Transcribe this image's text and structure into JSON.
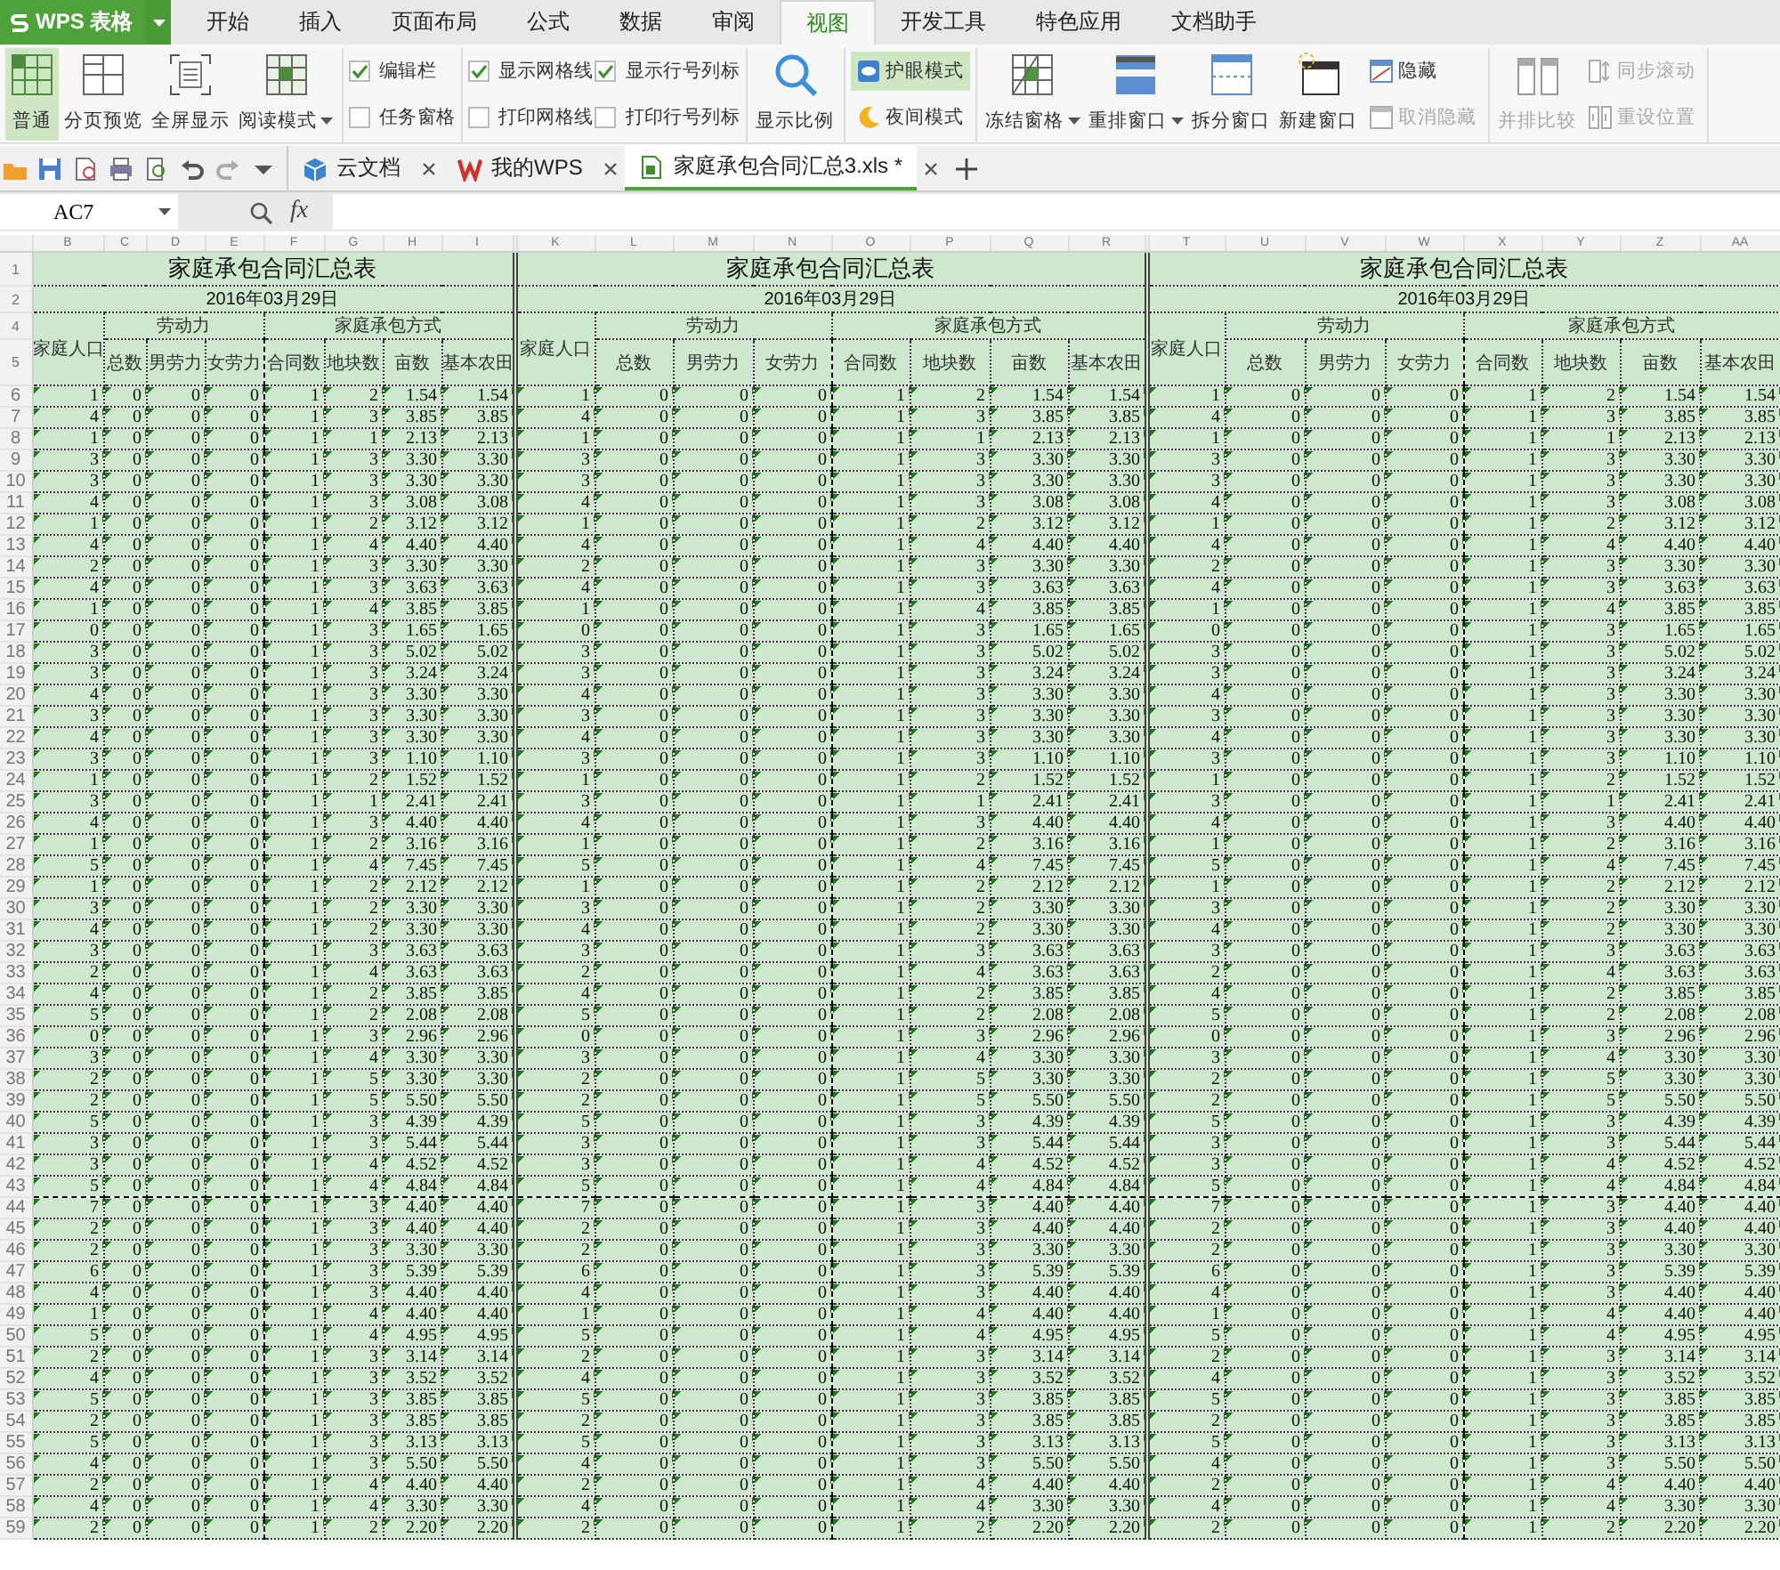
{
  "app_button": {
    "label": "WPS 表格"
  },
  "menu_tabs": [
    {
      "label": "开始",
      "selected": false
    },
    {
      "label": "插入",
      "selected": false
    },
    {
      "label": "页面布局",
      "selected": false
    },
    {
      "label": "公式",
      "selected": false
    },
    {
      "label": "数据",
      "selected": false
    },
    {
      "label": "审阅",
      "selected": false
    },
    {
      "label": "视图",
      "selected": true
    },
    {
      "label": "开发工具",
      "selected": false
    },
    {
      "label": "特色应用",
      "selected": false
    },
    {
      "label": "文档助手",
      "selected": false
    }
  ],
  "ribbon": {
    "groups": [
      {
        "items": [
          {
            "kind": "large",
            "label": "普通",
            "selected": true,
            "disabled": false,
            "dropdown": false
          },
          {
            "kind": "large",
            "label": "分页预览",
            "selected": false,
            "disabled": false,
            "dropdown": false
          },
          {
            "kind": "large",
            "label": "全屏显示",
            "selected": false,
            "disabled": false,
            "dropdown": false
          },
          {
            "kind": "large",
            "label": "阅读模式",
            "selected": false,
            "disabled": false,
            "dropdown": true
          }
        ]
      },
      {
        "items": [
          {
            "kind": "check",
            "label": "编辑栏",
            "checked": true
          },
          {
            "kind": "check",
            "label": "任务窗格",
            "checked": false
          }
        ]
      },
      {
        "items": [
          {
            "kind": "check",
            "label": "显示网格线",
            "checked": true
          },
          {
            "kind": "check",
            "label": "打印网格线",
            "checked": false
          },
          {
            "kind": "check",
            "label": "显示行号列标",
            "checked": true
          },
          {
            "kind": "check",
            "label": "打印行号列标",
            "checked": false
          }
        ]
      },
      {
        "items": [
          {
            "kind": "large",
            "label": "显示比例",
            "selected": false,
            "disabled": false,
            "dropdown": false
          }
        ]
      },
      {
        "items": [
          {
            "kind": "small",
            "label": "护眼模式",
            "selected": true,
            "disabled": false
          },
          {
            "kind": "small",
            "label": "夜间模式",
            "selected": false,
            "disabled": false
          }
        ]
      },
      {
        "items": [
          {
            "kind": "large",
            "label": "冻结窗格",
            "selected": false,
            "disabled": false,
            "dropdown": true
          },
          {
            "kind": "large",
            "label": "重排窗口",
            "selected": false,
            "disabled": false,
            "dropdown": true
          },
          {
            "kind": "large",
            "label": "拆分窗口",
            "selected": false,
            "disabled": false,
            "dropdown": false
          },
          {
            "kind": "large",
            "label": "新建窗口",
            "selected": false,
            "disabled": false,
            "dropdown": false
          },
          {
            "kind": "small",
            "label": "隐藏",
            "selected": false,
            "disabled": false
          },
          {
            "kind": "small",
            "label": "取消隐藏",
            "selected": false,
            "disabled": true
          }
        ]
      },
      {
        "items": [
          {
            "kind": "large",
            "label": "并排比较",
            "selected": false,
            "disabled": true,
            "dropdown": false
          },
          {
            "kind": "small",
            "label": "同步滚动",
            "selected": false,
            "disabled": true
          },
          {
            "kind": "small",
            "label": "重设位置",
            "selected": false,
            "disabled": true
          }
        ]
      }
    ]
  },
  "doc_tabs": [
    {
      "label": "云文档",
      "selected": false
    },
    {
      "label": "我的WPS",
      "selected": false
    },
    {
      "label": "家庭承包合同汇总3.xls *",
      "selected": true
    }
  ],
  "formula_bar": {
    "name_box": "AC7",
    "function_label": "fx"
  },
  "sheet": {
    "row_numbers": [
      "1",
      "2",
      "4",
      "5",
      "6",
      "7",
      "8",
      "9",
      "10",
      "11",
      "12",
      "13",
      "14",
      "15",
      "16",
      "17",
      "18",
      "19",
      "20",
      "21",
      "22",
      "23",
      "24",
      "25",
      "26",
      "27",
      "28",
      "29",
      "30",
      "31",
      "32",
      "33",
      "34",
      "35",
      "36",
      "37",
      "38",
      "39",
      "40",
      "41",
      "42",
      "43",
      "44",
      "45",
      "46",
      "47",
      "48",
      "49",
      "50",
      "51",
      "52",
      "53",
      "54",
      "55",
      "56",
      "57",
      "58",
      "59"
    ],
    "blocks": [
      {
        "column_letters": [
          "B",
          "C",
          "D",
          "E",
          "F",
          "G",
          "H",
          "I"
        ],
        "title": "家庭承包合同汇总表",
        "date": "2016年03月29日",
        "population_header": "家庭人口",
        "labor": {
          "label": "劳动力",
          "columns": [
            "总数",
            "男劳力",
            "女劳力"
          ]
        },
        "contract": {
          "label": "家庭承包方式",
          "columns": [
            "合同数",
            "地块数",
            "亩数",
            "基本农田"
          ]
        },
        "rows": [
          [
            "1",
            "0",
            "0",
            "0",
            "1",
            "2",
            "1.54",
            "1.54"
          ],
          [
            "4",
            "0",
            "0",
            "0",
            "1",
            "3",
            "3.85",
            "3.85"
          ],
          [
            "1",
            "0",
            "0",
            "0",
            "1",
            "1",
            "2.13",
            "2.13"
          ],
          [
            "3",
            "0",
            "0",
            "0",
            "1",
            "3",
            "3.30",
            "3.30"
          ],
          [
            "3",
            "0",
            "0",
            "0",
            "1",
            "3",
            "3.30",
            "3.30"
          ],
          [
            "4",
            "0",
            "0",
            "0",
            "1",
            "3",
            "3.08",
            "3.08"
          ],
          [
            "1",
            "0",
            "0",
            "0",
            "1",
            "2",
            "3.12",
            "3.12"
          ],
          [
            "4",
            "0",
            "0",
            "0",
            "1",
            "4",
            "4.40",
            "4.40"
          ],
          [
            "2",
            "0",
            "0",
            "0",
            "1",
            "3",
            "3.30",
            "3.30"
          ],
          [
            "4",
            "0",
            "0",
            "0",
            "1",
            "3",
            "3.63",
            "3.63"
          ],
          [
            "1",
            "0",
            "0",
            "0",
            "1",
            "4",
            "3.85",
            "3.85"
          ],
          [
            "0",
            "0",
            "0",
            "0",
            "1",
            "3",
            "1.65",
            "1.65"
          ],
          [
            "3",
            "0",
            "0",
            "0",
            "1",
            "3",
            "5.02",
            "5.02"
          ],
          [
            "3",
            "0",
            "0",
            "0",
            "1",
            "3",
            "3.24",
            "3.24"
          ],
          [
            "4",
            "0",
            "0",
            "0",
            "1",
            "3",
            "3.30",
            "3.30"
          ],
          [
            "3",
            "0",
            "0",
            "0",
            "1",
            "3",
            "3.30",
            "3.30"
          ],
          [
            "4",
            "0",
            "0",
            "0",
            "1",
            "3",
            "3.30",
            "3.30"
          ],
          [
            "3",
            "0",
            "0",
            "0",
            "1",
            "3",
            "1.10",
            "1.10"
          ],
          [
            "1",
            "0",
            "0",
            "0",
            "1",
            "2",
            "1.52",
            "1.52"
          ],
          [
            "3",
            "0",
            "0",
            "0",
            "1",
            "1",
            "2.41",
            "2.41"
          ],
          [
            "4",
            "0",
            "0",
            "0",
            "1",
            "3",
            "4.40",
            "4.40"
          ],
          [
            "1",
            "0",
            "0",
            "0",
            "1",
            "2",
            "3.16",
            "3.16"
          ],
          [
            "5",
            "0",
            "0",
            "0",
            "1",
            "4",
            "7.45",
            "7.45"
          ],
          [
            "1",
            "0",
            "0",
            "0",
            "1",
            "2",
            "2.12",
            "2.12"
          ],
          [
            "3",
            "0",
            "0",
            "0",
            "1",
            "2",
            "3.30",
            "3.30"
          ],
          [
            "4",
            "0",
            "0",
            "0",
            "1",
            "2",
            "3.30",
            "3.30"
          ],
          [
            "3",
            "0",
            "0",
            "0",
            "1",
            "3",
            "3.63",
            "3.63"
          ],
          [
            "2",
            "0",
            "0",
            "0",
            "1",
            "4",
            "3.63",
            "3.63"
          ],
          [
            "4",
            "0",
            "0",
            "0",
            "1",
            "2",
            "3.85",
            "3.85"
          ],
          [
            "5",
            "0",
            "0",
            "0",
            "1",
            "2",
            "2.08",
            "2.08"
          ],
          [
            "0",
            "0",
            "0",
            "0",
            "1",
            "3",
            "2.96",
            "2.96"
          ],
          [
            "3",
            "0",
            "0",
            "0",
            "1",
            "4",
            "3.30",
            "3.30"
          ],
          [
            "2",
            "0",
            "0",
            "0",
            "1",
            "5",
            "3.30",
            "3.30"
          ],
          [
            "2",
            "0",
            "0",
            "0",
            "1",
            "5",
            "5.50",
            "5.50"
          ],
          [
            "5",
            "0",
            "0",
            "0",
            "1",
            "3",
            "4.39",
            "4.39"
          ],
          [
            "3",
            "0",
            "0",
            "0",
            "1",
            "3",
            "5.44",
            "5.44"
          ],
          [
            "3",
            "0",
            "0",
            "0",
            "1",
            "4",
            "4.52",
            "4.52"
          ],
          [
            "5",
            "0",
            "0",
            "0",
            "1",
            "4",
            "4.84",
            "4.84"
          ],
          [
            "7",
            "0",
            "0",
            "0",
            "1",
            "3",
            "4.40",
            "4.40"
          ],
          [
            "2",
            "0",
            "0",
            "0",
            "1",
            "3",
            "4.40",
            "4.40"
          ],
          [
            "2",
            "0",
            "0",
            "0",
            "1",
            "3",
            "3.30",
            "3.30"
          ],
          [
            "6",
            "0",
            "0",
            "0",
            "1",
            "3",
            "5.39",
            "5.39"
          ],
          [
            "4",
            "0",
            "0",
            "0",
            "1",
            "3",
            "4.40",
            "4.40"
          ],
          [
            "1",
            "0",
            "0",
            "0",
            "1",
            "4",
            "4.40",
            "4.40"
          ],
          [
            "5",
            "0",
            "0",
            "0",
            "1",
            "4",
            "4.95",
            "4.95"
          ],
          [
            "2",
            "0",
            "0",
            "0",
            "1",
            "3",
            "3.14",
            "3.14"
          ],
          [
            "4",
            "0",
            "0",
            "0",
            "1",
            "3",
            "3.52",
            "3.52"
          ],
          [
            "5",
            "0",
            "0",
            "0",
            "1",
            "3",
            "3.85",
            "3.85"
          ],
          [
            "2",
            "0",
            "0",
            "0",
            "1",
            "3",
            "3.85",
            "3.85"
          ],
          [
            "5",
            "0",
            "0",
            "0",
            "1",
            "3",
            "3.13",
            "3.13"
          ],
          [
            "4",
            "0",
            "0",
            "0",
            "1",
            "3",
            "5.50",
            "5.50"
          ],
          [
            "2",
            "0",
            "0",
            "0",
            "1",
            "4",
            "4.40",
            "4.40"
          ],
          [
            "4",
            "0",
            "0",
            "0",
            "1",
            "4",
            "3.30",
            "3.30"
          ],
          [
            "2",
            "0",
            "0",
            "0",
            "1",
            "2",
            "2.20",
            "2.20"
          ]
        ]
      },
      {
        "column_letters": [
          "K",
          "L",
          "M",
          "N",
          "O",
          "P",
          "Q",
          "R"
        ],
        "title": "家庭承包合同汇总表",
        "date": "2016年03月29日",
        "population_header": "家庭人口",
        "labor": {
          "label": "劳动力",
          "columns": [
            "总数",
            "男劳力",
            "女劳力"
          ]
        },
        "contract": {
          "label": "家庭承包方式",
          "columns": [
            "合同数",
            "地块数",
            "亩数",
            "基本农田"
          ]
        },
        "rows": [
          [
            "1",
            "0",
            "0",
            "0",
            "1",
            "2",
            "1.54",
            "1.54"
          ],
          [
            "4",
            "0",
            "0",
            "0",
            "1",
            "3",
            "3.85",
            "3.85"
          ],
          [
            "1",
            "0",
            "0",
            "0",
            "1",
            "1",
            "2.13",
            "2.13"
          ],
          [
            "3",
            "0",
            "0",
            "0",
            "1",
            "3",
            "3.30",
            "3.30"
          ],
          [
            "3",
            "0",
            "0",
            "0",
            "1",
            "3",
            "3.30",
            "3.30"
          ],
          [
            "4",
            "0",
            "0",
            "0",
            "1",
            "3",
            "3.08",
            "3.08"
          ],
          [
            "1",
            "0",
            "0",
            "0",
            "1",
            "2",
            "3.12",
            "3.12"
          ],
          [
            "4",
            "0",
            "0",
            "0",
            "1",
            "4",
            "4.40",
            "4.40"
          ],
          [
            "2",
            "0",
            "0",
            "0",
            "1",
            "3",
            "3.30",
            "3.30"
          ],
          [
            "4",
            "0",
            "0",
            "0",
            "1",
            "3",
            "3.63",
            "3.63"
          ],
          [
            "1",
            "0",
            "0",
            "0",
            "1",
            "4",
            "3.85",
            "3.85"
          ],
          [
            "0",
            "0",
            "0",
            "0",
            "1",
            "3",
            "1.65",
            "1.65"
          ],
          [
            "3",
            "0",
            "0",
            "0",
            "1",
            "3",
            "5.02",
            "5.02"
          ],
          [
            "3",
            "0",
            "0",
            "0",
            "1",
            "3",
            "3.24",
            "3.24"
          ],
          [
            "4",
            "0",
            "0",
            "0",
            "1",
            "3",
            "3.30",
            "3.30"
          ],
          [
            "3",
            "0",
            "0",
            "0",
            "1",
            "3",
            "3.30",
            "3.30"
          ],
          [
            "4",
            "0",
            "0",
            "0",
            "1",
            "3",
            "3.30",
            "3.30"
          ],
          [
            "3",
            "0",
            "0",
            "0",
            "1",
            "3",
            "1.10",
            "1.10"
          ],
          [
            "1",
            "0",
            "0",
            "0",
            "1",
            "2",
            "1.52",
            "1.52"
          ],
          [
            "3",
            "0",
            "0",
            "0",
            "1",
            "1",
            "2.41",
            "2.41"
          ],
          [
            "4",
            "0",
            "0",
            "0",
            "1",
            "3",
            "4.40",
            "4.40"
          ],
          [
            "1",
            "0",
            "0",
            "0",
            "1",
            "2",
            "3.16",
            "3.16"
          ],
          [
            "5",
            "0",
            "0",
            "0",
            "1",
            "4",
            "7.45",
            "7.45"
          ],
          [
            "1",
            "0",
            "0",
            "0",
            "1",
            "2",
            "2.12",
            "2.12"
          ],
          [
            "3",
            "0",
            "0",
            "0",
            "1",
            "2",
            "3.30",
            "3.30"
          ],
          [
            "4",
            "0",
            "0",
            "0",
            "1",
            "2",
            "3.30",
            "3.30"
          ],
          [
            "3",
            "0",
            "0",
            "0",
            "1",
            "3",
            "3.63",
            "3.63"
          ],
          [
            "2",
            "0",
            "0",
            "0",
            "1",
            "4",
            "3.63",
            "3.63"
          ],
          [
            "4",
            "0",
            "0",
            "0",
            "1",
            "2",
            "3.85",
            "3.85"
          ],
          [
            "5",
            "0",
            "0",
            "0",
            "1",
            "2",
            "2.08",
            "2.08"
          ],
          [
            "0",
            "0",
            "0",
            "0",
            "1",
            "3",
            "2.96",
            "2.96"
          ],
          [
            "3",
            "0",
            "0",
            "0",
            "1",
            "4",
            "3.30",
            "3.30"
          ],
          [
            "2",
            "0",
            "0",
            "0",
            "1",
            "5",
            "3.30",
            "3.30"
          ],
          [
            "2",
            "0",
            "0",
            "0",
            "1",
            "5",
            "5.50",
            "5.50"
          ],
          [
            "5",
            "0",
            "0",
            "0",
            "1",
            "3",
            "4.39",
            "4.39"
          ],
          [
            "3",
            "0",
            "0",
            "0",
            "1",
            "3",
            "5.44",
            "5.44"
          ],
          [
            "3",
            "0",
            "0",
            "0",
            "1",
            "4",
            "4.52",
            "4.52"
          ],
          [
            "5",
            "0",
            "0",
            "0",
            "1",
            "4",
            "4.84",
            "4.84"
          ],
          [
            "7",
            "0",
            "0",
            "0",
            "1",
            "3",
            "4.40",
            "4.40"
          ],
          [
            "2",
            "0",
            "0",
            "0",
            "1",
            "3",
            "4.40",
            "4.40"
          ],
          [
            "2",
            "0",
            "0",
            "0",
            "1",
            "3",
            "3.30",
            "3.30"
          ],
          [
            "6",
            "0",
            "0",
            "0",
            "1",
            "3",
            "5.39",
            "5.39"
          ],
          [
            "4",
            "0",
            "0",
            "0",
            "1",
            "3",
            "4.40",
            "4.40"
          ],
          [
            "1",
            "0",
            "0",
            "0",
            "1",
            "4",
            "4.40",
            "4.40"
          ],
          [
            "5",
            "0",
            "0",
            "0",
            "1",
            "4",
            "4.95",
            "4.95"
          ],
          [
            "2",
            "0",
            "0",
            "0",
            "1",
            "3",
            "3.14",
            "3.14"
          ],
          [
            "4",
            "0",
            "0",
            "0",
            "1",
            "3",
            "3.52",
            "3.52"
          ],
          [
            "5",
            "0",
            "0",
            "0",
            "1",
            "3",
            "3.85",
            "3.85"
          ],
          [
            "2",
            "0",
            "0",
            "0",
            "1",
            "3",
            "3.85",
            "3.85"
          ],
          [
            "5",
            "0",
            "0",
            "0",
            "1",
            "3",
            "3.13",
            "3.13"
          ],
          [
            "4",
            "0",
            "0",
            "0",
            "1",
            "3",
            "5.50",
            "5.50"
          ],
          [
            "2",
            "0",
            "0",
            "0",
            "1",
            "4",
            "4.40",
            "4.40"
          ],
          [
            "4",
            "0",
            "0",
            "0",
            "1",
            "4",
            "3.30",
            "3.30"
          ],
          [
            "2",
            "0",
            "0",
            "0",
            "1",
            "2",
            "2.20",
            "2.20"
          ]
        ]
      },
      {
        "column_letters": [
          "T",
          "U",
          "V",
          "W",
          "X",
          "Y",
          "Z",
          "AA"
        ],
        "title": "家庭承包合同汇总表",
        "date": "2016年03月29日",
        "population_header": "家庭人口",
        "labor": {
          "label": "劳动力",
          "columns": [
            "总数",
            "男劳力",
            "女劳力"
          ]
        },
        "contract": {
          "label": "家庭承包方式",
          "columns": [
            "合同数",
            "地块数",
            "亩数",
            "基本农田"
          ]
        },
        "rows": [
          [
            "1",
            "0",
            "0",
            "0",
            "1",
            "2",
            "1.54",
            "1.54"
          ],
          [
            "4",
            "0",
            "0",
            "0",
            "1",
            "3",
            "3.85",
            "3.85"
          ],
          [
            "1",
            "0",
            "0",
            "0",
            "1",
            "1",
            "2.13",
            "2.13"
          ],
          [
            "3",
            "0",
            "0",
            "0",
            "1",
            "3",
            "3.30",
            "3.30"
          ],
          [
            "3",
            "0",
            "0",
            "0",
            "1",
            "3",
            "3.30",
            "3.30"
          ],
          [
            "4",
            "0",
            "0",
            "0",
            "1",
            "3",
            "3.08",
            "3.08"
          ],
          [
            "1",
            "0",
            "0",
            "0",
            "1",
            "2",
            "3.12",
            "3.12"
          ],
          [
            "4",
            "0",
            "0",
            "0",
            "1",
            "4",
            "4.40",
            "4.40"
          ],
          [
            "2",
            "0",
            "0",
            "0",
            "1",
            "3",
            "3.30",
            "3.30"
          ],
          [
            "4",
            "0",
            "0",
            "0",
            "1",
            "3",
            "3.63",
            "3.63"
          ],
          [
            "1",
            "0",
            "0",
            "0",
            "1",
            "4",
            "3.85",
            "3.85"
          ],
          [
            "0",
            "0",
            "0",
            "0",
            "1",
            "3",
            "1.65",
            "1.65"
          ],
          [
            "3",
            "0",
            "0",
            "0",
            "1",
            "3",
            "5.02",
            "5.02"
          ],
          [
            "3",
            "0",
            "0",
            "0",
            "1",
            "3",
            "3.24",
            "3.24"
          ],
          [
            "4",
            "0",
            "0",
            "0",
            "1",
            "3",
            "3.30",
            "3.30"
          ],
          [
            "3",
            "0",
            "0",
            "0",
            "1",
            "3",
            "3.30",
            "3.30"
          ],
          [
            "4",
            "0",
            "0",
            "0",
            "1",
            "3",
            "3.30",
            "3.30"
          ],
          [
            "3",
            "0",
            "0",
            "0",
            "1",
            "3",
            "1.10",
            "1.10"
          ],
          [
            "1",
            "0",
            "0",
            "0",
            "1",
            "2",
            "1.52",
            "1.52"
          ],
          [
            "3",
            "0",
            "0",
            "0",
            "1",
            "1",
            "2.41",
            "2.41"
          ],
          [
            "4",
            "0",
            "0",
            "0",
            "1",
            "3",
            "4.40",
            "4.40"
          ],
          [
            "1",
            "0",
            "0",
            "0",
            "1",
            "2",
            "3.16",
            "3.16"
          ],
          [
            "5",
            "0",
            "0",
            "0",
            "1",
            "4",
            "7.45",
            "7.45"
          ],
          [
            "1",
            "0",
            "0",
            "0",
            "1",
            "2",
            "2.12",
            "2.12"
          ],
          [
            "3",
            "0",
            "0",
            "0",
            "1",
            "2",
            "3.30",
            "3.30"
          ],
          [
            "4",
            "0",
            "0",
            "0",
            "1",
            "2",
            "3.30",
            "3.30"
          ],
          [
            "3",
            "0",
            "0",
            "0",
            "1",
            "3",
            "3.63",
            "3.63"
          ],
          [
            "2",
            "0",
            "0",
            "0",
            "1",
            "4",
            "3.63",
            "3.63"
          ],
          [
            "4",
            "0",
            "0",
            "0",
            "1",
            "2",
            "3.85",
            "3.85"
          ],
          [
            "5",
            "0",
            "0",
            "0",
            "1",
            "2",
            "2.08",
            "2.08"
          ],
          [
            "0",
            "0",
            "0",
            "0",
            "1",
            "3",
            "2.96",
            "2.96"
          ],
          [
            "3",
            "0",
            "0",
            "0",
            "1",
            "4",
            "3.30",
            "3.30"
          ],
          [
            "2",
            "0",
            "0",
            "0",
            "1",
            "5",
            "3.30",
            "3.30"
          ],
          [
            "2",
            "0",
            "0",
            "0",
            "1",
            "5",
            "5.50",
            "5.50"
          ],
          [
            "5",
            "0",
            "0",
            "0",
            "1",
            "3",
            "4.39",
            "4.39"
          ],
          [
            "3",
            "0",
            "0",
            "0",
            "1",
            "3",
            "5.44",
            "5.44"
          ],
          [
            "3",
            "0",
            "0",
            "0",
            "1",
            "4",
            "4.52",
            "4.52"
          ],
          [
            "5",
            "0",
            "0",
            "0",
            "1",
            "4",
            "4.84",
            "4.84"
          ],
          [
            "7",
            "0",
            "0",
            "0",
            "1",
            "3",
            "4.40",
            "4.40"
          ],
          [
            "2",
            "0",
            "0",
            "0",
            "1",
            "3",
            "4.40",
            "4.40"
          ],
          [
            "2",
            "0",
            "0",
            "0",
            "1",
            "3",
            "3.30",
            "3.30"
          ],
          [
            "6",
            "0",
            "0",
            "0",
            "1",
            "3",
            "5.39",
            "5.39"
          ],
          [
            "4",
            "0",
            "0",
            "0",
            "1",
            "3",
            "4.40",
            "4.40"
          ],
          [
            "1",
            "0",
            "0",
            "0",
            "1",
            "4",
            "4.40",
            "4.40"
          ],
          [
            "5",
            "0",
            "0",
            "0",
            "1",
            "4",
            "4.95",
            "4.95"
          ],
          [
            "2",
            "0",
            "0",
            "0",
            "1",
            "3",
            "3.14",
            "3.14"
          ],
          [
            "4",
            "0",
            "0",
            "0",
            "1",
            "3",
            "3.52",
            "3.52"
          ],
          [
            "5",
            "0",
            "0",
            "0",
            "1",
            "3",
            "3.85",
            "3.85"
          ],
          [
            "2",
            "0",
            "0",
            "0",
            "1",
            "3",
            "3.85",
            "3.85"
          ],
          [
            "5",
            "0",
            "0",
            "0",
            "1",
            "3",
            "3.13",
            "3.13"
          ],
          [
            "4",
            "0",
            "0",
            "0",
            "1",
            "3",
            "5.50",
            "5.50"
          ],
          [
            "2",
            "0",
            "0",
            "0",
            "1",
            "4",
            "4.40",
            "4.40"
          ],
          [
            "4",
            "0",
            "0",
            "0",
            "1",
            "4",
            "3.30",
            "3.30"
          ],
          [
            "2",
            "0",
            "0",
            "0",
            "1",
            "2",
            "2.20",
            "2.20"
          ]
        ]
      }
    ]
  }
}
